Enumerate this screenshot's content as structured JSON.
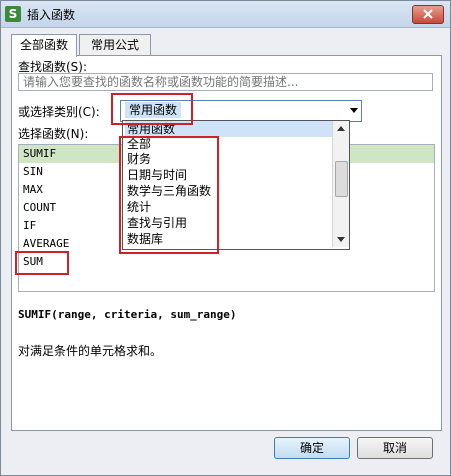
{
  "window": {
    "title": "插入函数",
    "app_icon_glyph": "S"
  },
  "tabs": [
    {
      "label": "全部函数",
      "active": true
    },
    {
      "label": "常用公式",
      "active": false
    }
  ],
  "search": {
    "label": "查找函数(S):",
    "placeholder": "请输入您要查找的函数名称或函数功能的简要描述..."
  },
  "category": {
    "label": "或选择类别(C):",
    "selected": "常用函数"
  },
  "function_list": {
    "label": "选择函数(N):",
    "items": [
      "SUMIF",
      "SIN",
      "MAX",
      "COUNT",
      "IF",
      "AVERAGE",
      "SUM"
    ],
    "selected_index": 0
  },
  "dropdown_options": [
    "常用函数",
    "全部",
    "财务",
    "日期与时间",
    "数学与三角函数",
    "统计",
    "查找与引用",
    "数据库"
  ],
  "selected_function": {
    "signature": "SUMIF(range, criteria, sum_range)",
    "description": "对满足条件的单元格求和。"
  },
  "buttons": {
    "ok": "确定",
    "cancel": "取消"
  },
  "colors": {
    "highlight_box": "#d0202a",
    "selected_row": "#cfe5c4",
    "selected_option": "#cfe3f8"
  }
}
